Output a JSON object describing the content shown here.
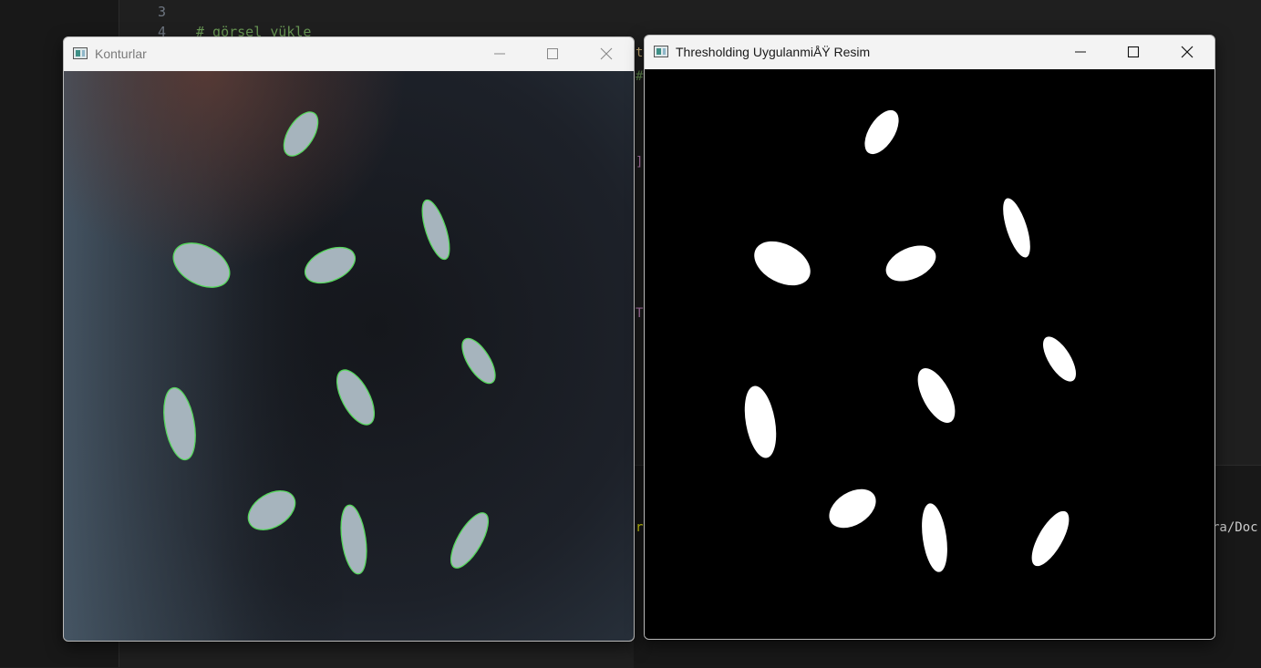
{
  "editor": {
    "line_number_3": "3",
    "line_number_4": "4",
    "comment_line_4": "# görsel yükle",
    "fragments": [
      "t",
      "#",
      "]",
      "TE",
      "rs",
      "ra/Doc"
    ]
  },
  "window_left": {
    "title": "Konturlar",
    "title_color": "#7a7a7a",
    "image": "rice grains on dark background with green contour outlines"
  },
  "window_right": {
    "title": "Thresholding UygulanmiÅŸ Resim",
    "title_color": "#1a1a1a",
    "image": "binary threshold mask: white rice grains on black"
  },
  "colors": {
    "contour": "#56d85c",
    "grain": "#a6b4bd",
    "editor_bg": "#1f1f1f"
  },
  "icons": [
    "minimize-icon",
    "maximize-icon",
    "close-icon",
    "app-icon"
  ]
}
